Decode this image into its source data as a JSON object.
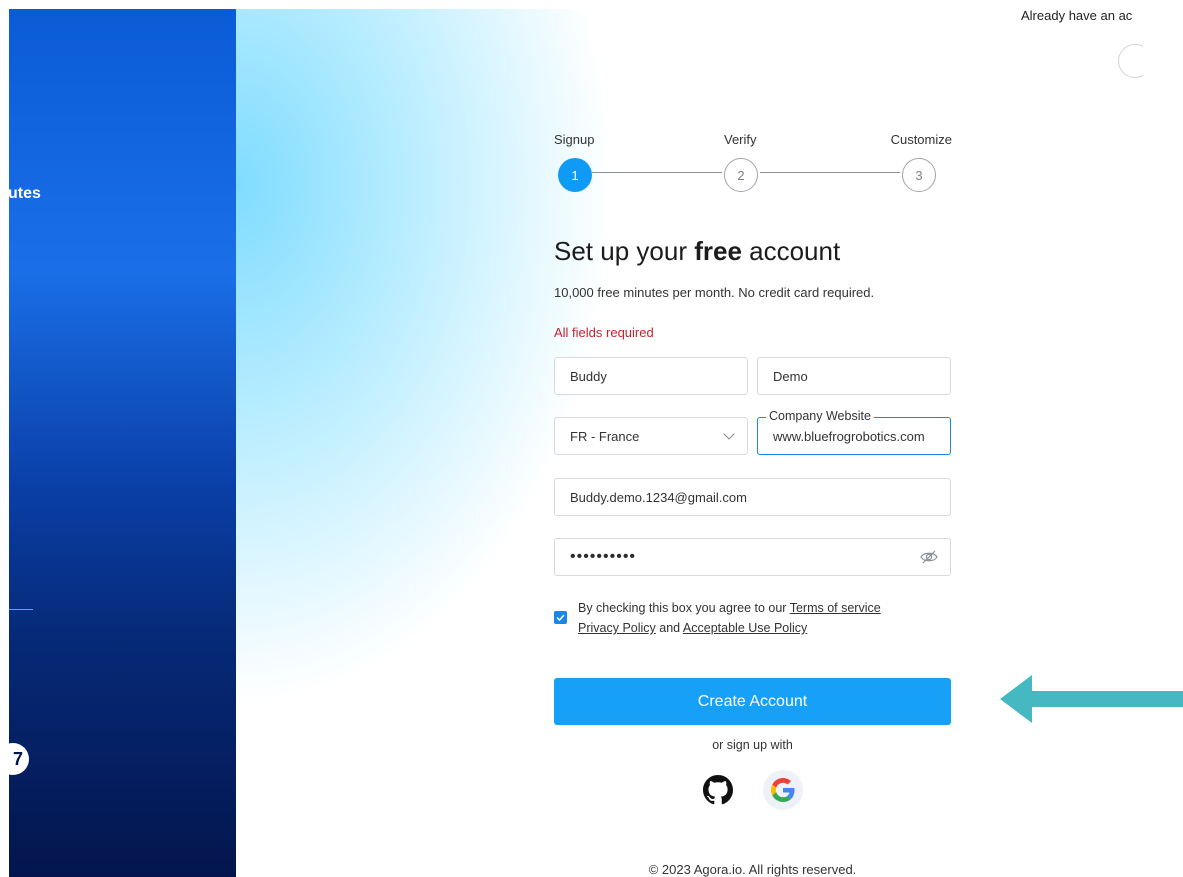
{
  "left_panel": {
    "tagline": "utes",
    "badge": "7"
  },
  "header": {
    "login_prompt": "Already have an ac"
  },
  "stepper": {
    "steps": [
      {
        "label": "Signup",
        "number": "1",
        "state": "active"
      },
      {
        "label": "Verify",
        "number": "2",
        "state": "idle"
      },
      {
        "label": "Customize",
        "number": "3",
        "state": "idle"
      }
    ]
  },
  "form": {
    "heading_pre": "Set up your ",
    "heading_bold": "free",
    "heading_post": " account",
    "subtext": "10,000 free minutes per month. No credit card required.",
    "required_note": "All fields required",
    "first_name": "Buddy",
    "last_name": "Demo",
    "country": "FR - France",
    "website_label": "Company Website",
    "website": "www.bluefrogrobotics.com",
    "email": "Buddy.demo.1234@gmail.com",
    "password_mask": "••••••••••",
    "consent_text": "By checking this box you agree to our ",
    "terms_link": "Terms of service",
    "privacy_link": "Privacy Policy",
    "consent_and": " and ",
    "aup_link": "Acceptable Use Policy",
    "consent_checked": true,
    "submit_label": "Create Account",
    "alt_signup": "or sign up with"
  },
  "social": [
    {
      "name": "github",
      "icon": "github-icon"
    },
    {
      "name": "google",
      "icon": "google-icon"
    }
  ],
  "footer": {
    "copyright": "© 2023 Agora.io. All rights reserved."
  },
  "colors": {
    "primary": "#16a0f7",
    "error": "#c8232c",
    "annotation_arrow": "#45b8c2"
  }
}
